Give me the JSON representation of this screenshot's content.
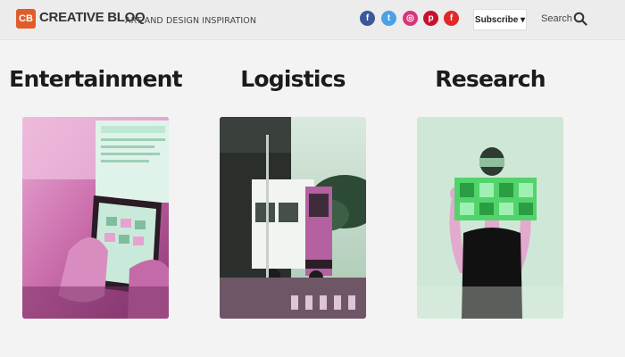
{
  "header": {
    "logo_badge": "CB",
    "logo_text": "CREATIVE BLOQ",
    "tagline": "ART AND DESIGN INSPIRATION",
    "social": [
      {
        "name": "facebook-icon",
        "glyph": "f",
        "color": "#3b5998"
      },
      {
        "name": "twitter-icon",
        "glyph": "t",
        "color": "#4aa1e8"
      },
      {
        "name": "instagram-icon",
        "glyph": "◎",
        "color": "#d8357a"
      },
      {
        "name": "pinterest-icon",
        "glyph": "p",
        "color": "#c8102e"
      },
      {
        "name": "flipboard-icon",
        "glyph": "f",
        "color": "#e12828"
      }
    ],
    "subscribe_label": "Subscribe ▾",
    "search_label": "Search"
  },
  "cards": [
    {
      "title": "Entertainment",
      "image": "tablet-hands-image"
    },
    {
      "title": "Logistics",
      "image": "truck-image"
    },
    {
      "title": "Research",
      "image": "person-holding-glass-image"
    }
  ]
}
